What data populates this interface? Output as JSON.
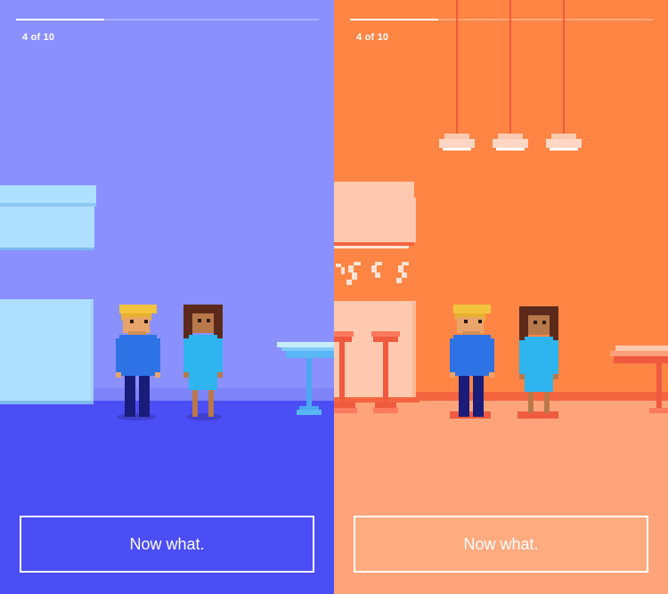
{
  "screens": [
    {
      "id": "left",
      "progress": {
        "label": "4 of 10",
        "fraction": 0.29
      },
      "cta_label": "Now what.",
      "colors": {
        "background": "#8B90FF",
        "floor": "#4B4DF5",
        "accent": "#AEE0FF"
      }
    },
    {
      "id": "right",
      "progress": {
        "label": "4 of 10",
        "fraction": 0.29
      },
      "cta_label": "Now what.",
      "colors": {
        "background": "#FF8545",
        "floor": "#FFA47A",
        "accent": "#FFC9B0"
      }
    }
  ],
  "characters": [
    {
      "name": "blonde-man",
      "hair": "#F2C43D",
      "skin": "#E9A46A",
      "shirt": "#2E73E6",
      "pants": "#1A1C7A"
    },
    {
      "name": "brunette-woman",
      "hair": "#5B2A1B",
      "skin": "#B9784A",
      "dress": "#2EB4EE"
    }
  ]
}
